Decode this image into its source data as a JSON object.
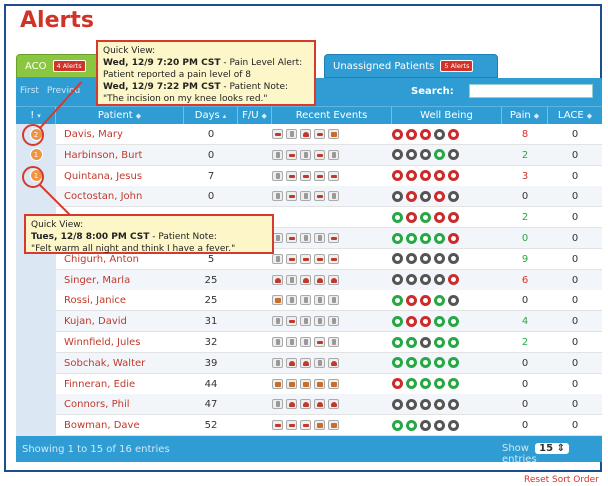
{
  "page_title": "Alerts",
  "tabs": [
    {
      "label": "ACO",
      "badge": "4 Alerts"
    },
    {
      "label": "Unassigned Patients",
      "badge": "5 Alerts"
    }
  ],
  "pager": {
    "first": "First",
    "previous": "Previou"
  },
  "search": {
    "label": "Search:",
    "value": ""
  },
  "columns": {
    "flag": "!",
    "patient": "Patient",
    "days": "Days",
    "fu": "F/U",
    "events": "Recent Events",
    "well_being": "Well Being",
    "pain": "Pain",
    "lace": "LACE"
  },
  "rows": [
    {
      "flag": "2",
      "patient": "Davis, Mary",
      "days": "0",
      "pain": "8",
      "pain_color": "#d0332a",
      "lace": "0",
      "events": [
        "e-bed",
        "e-doc",
        "e-heart",
        "e-pill",
        "e-sym"
      ],
      "well": [
        "r",
        "r",
        "r",
        "k",
        "r"
      ]
    },
    {
      "flag": "1",
      "patient": "Harbinson, Burt",
      "days": "0",
      "pain": "2",
      "pain_color": "#28a745",
      "lace": "0",
      "events": [
        "e-doc",
        "e-bed",
        "e-doc",
        "e-bed",
        "e-doc"
      ],
      "well": [
        "k",
        "k",
        "k",
        "g",
        "k"
      ]
    },
    {
      "flag": "1",
      "patient": "Quintana, Jesus",
      "days": "7",
      "pain": "3",
      "pain_color": "#d0332a",
      "lace": "0",
      "events": [
        "e-doc",
        "e-bed",
        "e-bed",
        "e-bed",
        "e-bed"
      ],
      "well": [
        "r",
        "r",
        "r",
        "r",
        "r"
      ]
    },
    {
      "flag": "",
      "patient": "Coctostan, John",
      "days": "0",
      "pain": "0",
      "pain_color": "#333333",
      "lace": "0",
      "events": [
        "e-doc",
        "e-bed",
        "e-doc",
        "e-bed",
        "e-doc"
      ],
      "well": [
        "k",
        "r",
        "k",
        "r",
        "k"
      ]
    },
    {
      "flag": "",
      "patient": "",
      "days": "",
      "pain": "2",
      "pain_color": "#28a745",
      "lace": "0",
      "events": [],
      "well": [
        "g",
        "r",
        "g",
        "r",
        "r"
      ]
    },
    {
      "flag": "",
      "patient": "",
      "days": "",
      "pain": "0",
      "pain_color": "#28a745",
      "lace": "0",
      "events": [
        "e-doc",
        "e-bed",
        "e-doc",
        "e-doc",
        "e-bed"
      ],
      "well": [
        "g",
        "g",
        "g",
        "g",
        "r"
      ]
    },
    {
      "flag": "",
      "patient": "Chigurh, Anton",
      "days": "5",
      "pain": "9",
      "pain_color": "#28a745",
      "lace": "0",
      "events": [
        "e-doc",
        "e-bed",
        "e-bed",
        "e-bed",
        "e-bed"
      ],
      "well": [
        "k",
        "k",
        "k",
        "k",
        "k"
      ]
    },
    {
      "flag": "",
      "patient": "Singer, Marla",
      "days": "25",
      "pain": "6",
      "pain_color": "#d0332a",
      "lace": "0",
      "events": [
        "e-heart",
        "e-doc",
        "e-heart",
        "e-heart",
        "e-heart"
      ],
      "well": [
        "k",
        "k",
        "k",
        "k",
        "r"
      ]
    },
    {
      "flag": "",
      "patient": "Rossi, Janice",
      "days": "25",
      "pain": "0",
      "pain_color": "#333333",
      "lace": "0",
      "events": [
        "e-sym",
        "e-doc",
        "e-doc",
        "e-doc",
        "e-doc"
      ],
      "well": [
        "g",
        "r",
        "r",
        "g",
        "k"
      ]
    },
    {
      "flag": "",
      "patient": "Kujan, David",
      "days": "31",
      "pain": "4",
      "pain_color": "#28a745",
      "lace": "0",
      "events": [
        "e-doc",
        "e-bed",
        "e-doc",
        "e-doc",
        "e-doc"
      ],
      "well": [
        "g",
        "r",
        "r",
        "g",
        "g"
      ]
    },
    {
      "flag": "",
      "patient": "Winnfield, Jules",
      "days": "32",
      "pain": "2",
      "pain_color": "#28a745",
      "lace": "0",
      "events": [
        "e-doc",
        "e-doc",
        "e-doc",
        "e-bed",
        "e-doc"
      ],
      "well": [
        "g",
        "g",
        "k",
        "g",
        "g"
      ]
    },
    {
      "flag": "",
      "patient": "Sobchak, Walter",
      "days": "39",
      "pain": "0",
      "pain_color": "#333333",
      "lace": "0",
      "events": [
        "e-doc",
        "e-heart",
        "e-heart",
        "e-doc",
        "e-heart"
      ],
      "well": [
        "g",
        "g",
        "g",
        "g",
        "g"
      ]
    },
    {
      "flag": "",
      "patient": "Finneran, Edie",
      "days": "44",
      "pain": "0",
      "pain_color": "#333333",
      "lace": "0",
      "events": [
        "e-sym",
        "e-sym",
        "e-sym",
        "e-sym",
        "e-sym"
      ],
      "well": [
        "r",
        "g",
        "g",
        "g",
        "g"
      ]
    },
    {
      "flag": "",
      "patient": "Connors, Phil",
      "days": "47",
      "pain": "0",
      "pain_color": "#333333",
      "lace": "0",
      "events": [
        "e-doc",
        "e-heart",
        "e-heart",
        "e-heart",
        "e-heart"
      ],
      "well": [
        "k",
        "k",
        "k",
        "k",
        "k"
      ]
    },
    {
      "flag": "",
      "patient": "Bowman, Dave",
      "days": "52",
      "pain": "0",
      "pain_color": "#333333",
      "lace": "0",
      "events": [
        "e-bed",
        "e-bed",
        "e-bed",
        "e-sym",
        "e-sym"
      ],
      "well": [
        "g",
        "g",
        "k",
        "k",
        "k"
      ]
    }
  ],
  "footer": {
    "showing": "Showing 1 to 15 of 16 entries",
    "show_label": "Show",
    "page_size": "15",
    "entries_label": "entries"
  },
  "reset_sort": "Reset Sort Order",
  "popup1": {
    "title": "Quick View:",
    "l1_bold": "Wed, 12/9 7:20 PM CST",
    "l1_rest": " - Pain Level Alert:",
    "l2": "Patient reported a pain level of 8",
    "l3_bold": "Wed, 12/9 7:22 PM CST",
    "l3_rest": " - Patient Note:",
    "l4": "\"The incision on my knee looks red.\""
  },
  "popup2": {
    "title": "Quick View:",
    "l1_bold": "Tues, 12/8 8:00 PM CST",
    "l1_rest": " - Patient Note:",
    "l2": "\"Felt warm all night and think I have a fever.\""
  },
  "colors": {
    "accent_red": "#d0332a",
    "table_blue": "#2f9dd4",
    "aco_green": "#8ac640"
  }
}
